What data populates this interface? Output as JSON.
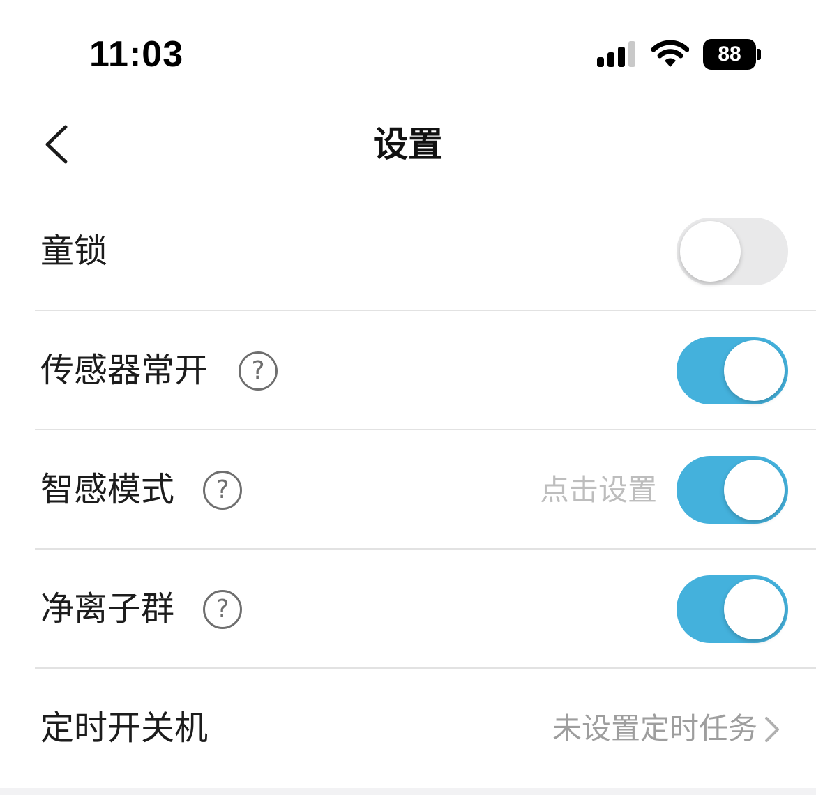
{
  "status_bar": {
    "time": "11:03",
    "battery": "88",
    "icons": [
      "signal-icon",
      "wifi-icon",
      "battery-icon"
    ]
  },
  "nav": {
    "title": "设置",
    "back_icon": "chevron-left-icon"
  },
  "settings": [
    {
      "label": "童锁",
      "toggle": "off"
    },
    {
      "label": "传感器常开",
      "help": "?",
      "toggle": "on"
    },
    {
      "label": "智感模式",
      "help": "?",
      "hint": "点击设置",
      "toggle": "on"
    },
    {
      "label": "净离子群",
      "help": "?",
      "toggle": "on"
    },
    {
      "label": "定时开关机",
      "value": "未设置定时任务",
      "icon": "chevron-right-icon"
    }
  ],
  "colors": {
    "toggle_on": "#44b1dc",
    "toggle_off": "#e9e9ea",
    "hint_text": "#bdbdbd",
    "divider": "#e2e2e2"
  }
}
